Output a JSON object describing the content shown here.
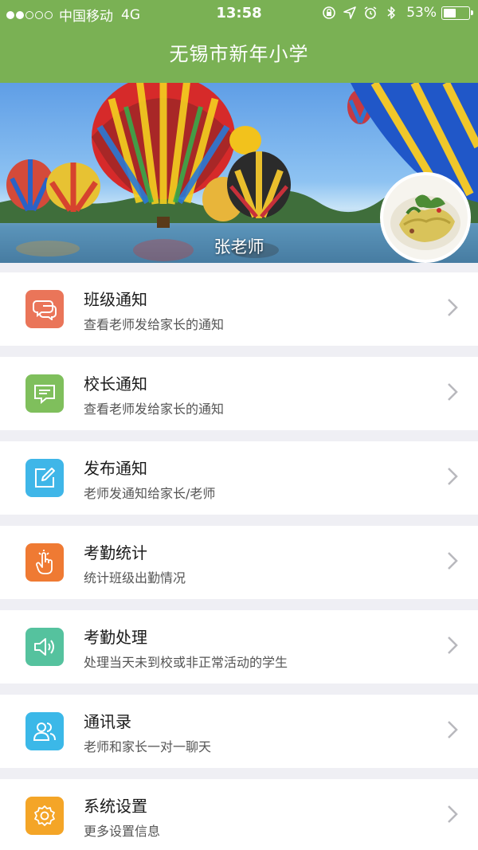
{
  "status_bar": {
    "carrier": "中国移动",
    "network": "4G",
    "time": "13:58",
    "battery_percent_text": "53%",
    "battery_level": 0.53,
    "icons": [
      "orientation-lock-icon",
      "location-arrow-icon",
      "alarm-icon",
      "bluetooth-icon"
    ]
  },
  "nav": {
    "title": "无锡市新年小学"
  },
  "banner": {
    "teacher_name": "张老师"
  },
  "menu": [
    {
      "title": "班级通知",
      "subtitle": "查看老师发给家长的通知",
      "icon": "chat-bubbles-icon",
      "color": "#ea7559"
    },
    {
      "title": "校长通知",
      "subtitle": "查看老师发给家长的通知",
      "icon": "message-box-icon",
      "color": "#7fbf5c"
    },
    {
      "title": "发布通知",
      "subtitle": "老师发通知给家长/老师",
      "icon": "edit-icon",
      "color": "#3fb6e8"
    },
    {
      "title": "考勤统计",
      "subtitle": "统计班级出勤情况",
      "icon": "tap-hand-icon",
      "color": "#ef7a33"
    },
    {
      "title": "考勤处理",
      "subtitle": "处理当天未到校或非正常活动的学生",
      "icon": "speaker-icon",
      "color": "#55c29e"
    },
    {
      "title": "通讯录",
      "subtitle": "老师和家长一对一聊天",
      "icon": "contacts-icon",
      "color": "#3bb8e8"
    },
    {
      "title": "系统设置",
      "subtitle": "更多设置信息",
      "icon": "gear-icon",
      "color": "#f4a527"
    }
  ],
  "colors": {
    "nav_bg": "#7ab154",
    "page_bg": "#efeff4",
    "chevron": "#b8b8bd"
  }
}
